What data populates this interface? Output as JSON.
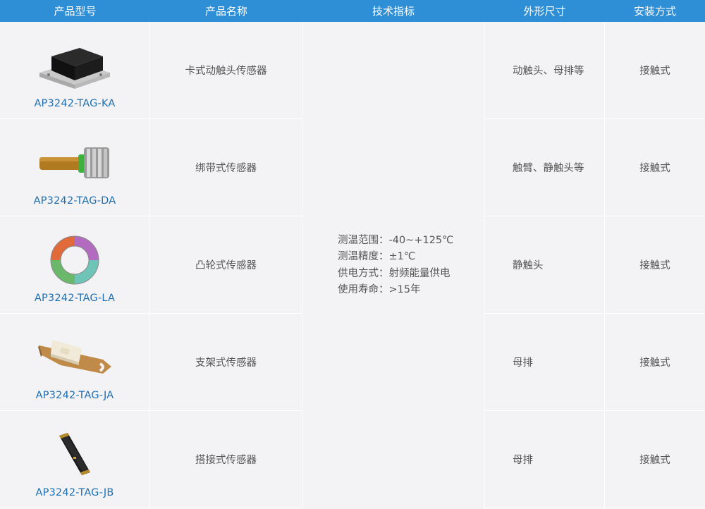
{
  "header": {
    "model": "产品型号",
    "name": "产品名称",
    "spec": "技术指标",
    "shape": "外形尺寸",
    "install": "安装方式"
  },
  "spec_lines": [
    "测温范围：-40~+125℃",
    "测温精度：±1℃",
    "供电方式：射频能量供电",
    "使用寿命：>15年"
  ],
  "rows": [
    {
      "model": "AP3242-TAG-KA",
      "name": "卡式动触头传感器",
      "shape": "动触头、母排等",
      "install": "接触式",
      "image": "black-sensor-on-plate"
    },
    {
      "model": "AP3242-TAG-DA",
      "name": "绑带式传感器",
      "shape": "触臂、静触头等",
      "install": "接触式",
      "image": "tube-sensor-with-contacts"
    },
    {
      "model": "AP3242-TAG-LA",
      "name": "凸轮式传感器",
      "shape": "静触头",
      "install": "接触式",
      "image": "ring-sensor"
    },
    {
      "model": "AP3242-TAG-JA",
      "name": "支架式传感器",
      "shape": "母排",
      "install": "接触式",
      "image": "bracket-sensor"
    },
    {
      "model": "AP3242-TAG-JB",
      "name": "搭接式传感器",
      "shape": "母排",
      "install": "接触式",
      "image": "strip-sensor"
    }
  ]
}
